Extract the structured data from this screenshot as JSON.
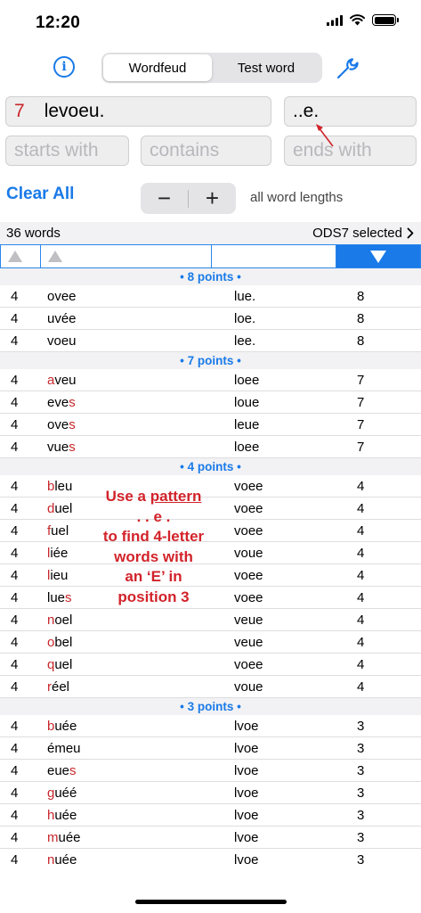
{
  "status": {
    "time": "12:20"
  },
  "header": {
    "tabs": [
      {
        "label": "Wordfeud",
        "active": true
      },
      {
        "label": "Test word",
        "active": false
      }
    ]
  },
  "inputs": {
    "letters_count": "7",
    "letters_value": "levoeu.",
    "pattern_value": "..e.",
    "starts_placeholder": "starts with",
    "contains_placeholder": "contains",
    "ends_placeholder": "ends with"
  },
  "controls": {
    "clear_all_label": "Clear All",
    "minus_label": "−",
    "plus_label": "+",
    "length_label": "all word lengths"
  },
  "summary": {
    "count_label": "36 words",
    "dictionary_label": "ODS7 selected"
  },
  "groups": [
    {
      "label": "• 8 points •",
      "rows": [
        {
          "len": "4",
          "hl": "",
          "rest": "ovee",
          "remain": "lue.",
          "pts": "8"
        },
        {
          "len": "4",
          "hl": "",
          "rest": "uvée",
          "remain": "loe.",
          "pts": "8"
        },
        {
          "len": "4",
          "hl": "",
          "rest": "voeu",
          "remain": "lee.",
          "pts": "8"
        }
      ]
    },
    {
      "label": "• 7 points •",
      "rows": [
        {
          "len": "4",
          "hl": "a",
          "rest": "veu",
          "remain": "loee",
          "pts": "7"
        },
        {
          "len": "4",
          "hl": "",
          "rest": "eve",
          "hl_end": "s",
          "remain": "loue",
          "pts": "7"
        },
        {
          "len": "4",
          "hl": "",
          "rest": "ove",
          "hl_end": "s",
          "remain": "leue",
          "pts": "7"
        },
        {
          "len": "4",
          "hl": "",
          "rest": "vue",
          "hl_end": "s",
          "remain": "loee",
          "pts": "7"
        }
      ]
    },
    {
      "label": "• 4 points •",
      "rows": [
        {
          "len": "4",
          "hl": "b",
          "rest": "leu",
          "remain": "voee",
          "pts": "4"
        },
        {
          "len": "4",
          "hl": "d",
          "rest": "uel",
          "remain": "voee",
          "pts": "4"
        },
        {
          "len": "4",
          "hl": "f",
          "rest": "uel",
          "remain": "voee",
          "pts": "4"
        },
        {
          "len": "4",
          "hl": "l",
          "rest": "iée",
          "remain": "voue",
          "pts": "4"
        },
        {
          "len": "4",
          "hl": "l",
          "rest": "ieu",
          "remain": "voee",
          "pts": "4"
        },
        {
          "len": "4",
          "hl": "",
          "rest": "lue",
          "hl_end": "s",
          "remain": "voee",
          "pts": "4"
        },
        {
          "len": "4",
          "hl": "n",
          "rest": "oel",
          "remain": "veue",
          "pts": "4"
        },
        {
          "len": "4",
          "hl": "o",
          "rest": "bel",
          "remain": "veue",
          "pts": "4"
        },
        {
          "len": "4",
          "hl": "q",
          "rest": "uel",
          "remain": "voee",
          "pts": "4"
        },
        {
          "len": "4",
          "hl": "r",
          "rest": "éel",
          "remain": "voue",
          "pts": "4"
        }
      ]
    },
    {
      "label": "• 3 points •",
      "rows": [
        {
          "len": "4",
          "hl": "b",
          "rest": "uée",
          "remain": "lvoe",
          "pts": "3"
        },
        {
          "len": "4",
          "hl": "",
          "rest": "émeu",
          "remain": "lvoe",
          "pts": "3"
        },
        {
          "len": "4",
          "hl": "",
          "rest": "eue",
          "hl_end": "s",
          "remain": "lvoe",
          "pts": "3"
        },
        {
          "len": "4",
          "hl": "g",
          "rest": "uéé",
          "remain": "lvoe",
          "pts": "3"
        },
        {
          "len": "4",
          "hl": "h",
          "rest": "uée",
          "remain": "lvoe",
          "pts": "3"
        },
        {
          "len": "4",
          "hl": "m",
          "rest": "uée",
          "remain": "lvoe",
          "pts": "3"
        },
        {
          "len": "4",
          "hl": "n",
          "rest": "uée",
          "remain": "lvoe",
          "pts": "3"
        }
      ]
    }
  ],
  "annotation": {
    "line1_prefix": "Use a ",
    "line1_underlined": "pattern",
    "line2": ". . e .",
    "line3": "to find 4-letter",
    "line4": "words with",
    "line5": "an ‘E’ in",
    "line6": "position 3"
  },
  "colors": {
    "accent": "#1a7ae8",
    "highlight": "#c8262a",
    "annotation": "#d2232a"
  }
}
